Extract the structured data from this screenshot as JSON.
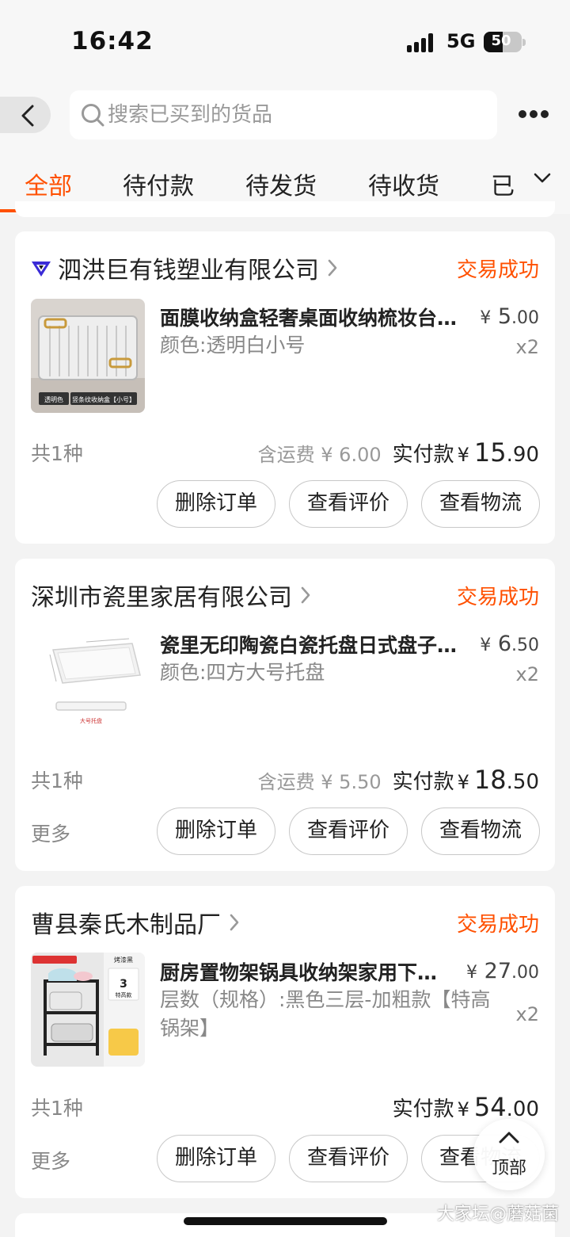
{
  "status_bar": {
    "time": "16:42",
    "network": "5G",
    "battery": 50,
    "battery_text": "50"
  },
  "search": {
    "placeholder": "搜索已买到的货品",
    "value": ""
  },
  "tabs": [
    {
      "label": "全部",
      "active": true
    },
    {
      "label": "待付款",
      "active": false
    },
    {
      "label": "待发货",
      "active": false
    },
    {
      "label": "待收货",
      "active": false
    },
    {
      "label": "已",
      "active": false
    }
  ],
  "orders": [
    {
      "shop": "泗洪巨有钱塑业有限公司",
      "status": "交易成功",
      "product": {
        "title": "面膜收纳盒轻奢桌面收纳梳妆台护肤品置物架",
        "sku": "颜色:透明白小号",
        "price_symbol": "¥",
        "price_int": "5",
        "price_dec": ".00",
        "qty": "x2",
        "thumb_caption_1": "透明色",
        "thumb_caption_2": "竖条纹收纳盒【小号】"
      },
      "kinds": "共1种",
      "shipping": "含运费 ¥ 6.00",
      "paid_label": "实付款",
      "paid_symbol": "¥",
      "paid_int": "15",
      "paid_dec": ".90",
      "more": "",
      "buttons": [
        "删除订单",
        "查看评价",
        "查看物流"
      ]
    },
    {
      "shop": "深圳市瓷里家居有限公司",
      "status": "交易成功",
      "product": {
        "title": "瓷里无印陶瓷白瓷托盘日式盘子长方形",
        "sku": "颜色:四方大号托盘",
        "price_symbol": "¥",
        "price_int": "6",
        "price_dec": ".50",
        "qty": "x2",
        "thumb_caption_1": "大号托盘"
      },
      "kinds": "共1种",
      "shipping": "含运费 ¥ 5.50",
      "paid_label": "实付款",
      "paid_symbol": "¥",
      "paid_int": "18",
      "paid_dec": ".50",
      "more": "更多",
      "buttons": [
        "删除订单",
        "查看评价",
        "查看物流"
      ]
    },
    {
      "shop": "曹县秦氏木制品厂",
      "status": "交易成功",
      "product": {
        "title": "厨房置物架锅具收纳架家用下水槽多层",
        "sku": "层数（规格）:黑色三层-加粗款【特高锅架】",
        "price_symbol": "¥",
        "price_int": "27",
        "price_dec": ".00",
        "qty": "x2",
        "thumb_caption_1": "烤漆黑",
        "thumb_caption_2": "3",
        "thumb_caption_3": "特高款"
      },
      "kinds": "共1种",
      "shipping": "",
      "paid_label": "实付款",
      "paid_symbol": "¥",
      "paid_int": "54",
      "paid_dec": ".00",
      "more": "更多",
      "buttons": [
        "删除订单",
        "查看评价",
        "查看物流"
      ]
    }
  ],
  "back_to_top": "顶部",
  "watermark": "大家坛@蘑菇菌",
  "colors": {
    "accent": "#ff5000",
    "background": "#f3f3f3",
    "card": "#ffffff",
    "muted": "#888888"
  },
  "icons": [
    "back-arrow-icon",
    "search-icon",
    "more-dots-icon",
    "chevron-down-icon",
    "chevron-right-icon",
    "shop-logo-icon",
    "arrow-up-icon"
  ]
}
